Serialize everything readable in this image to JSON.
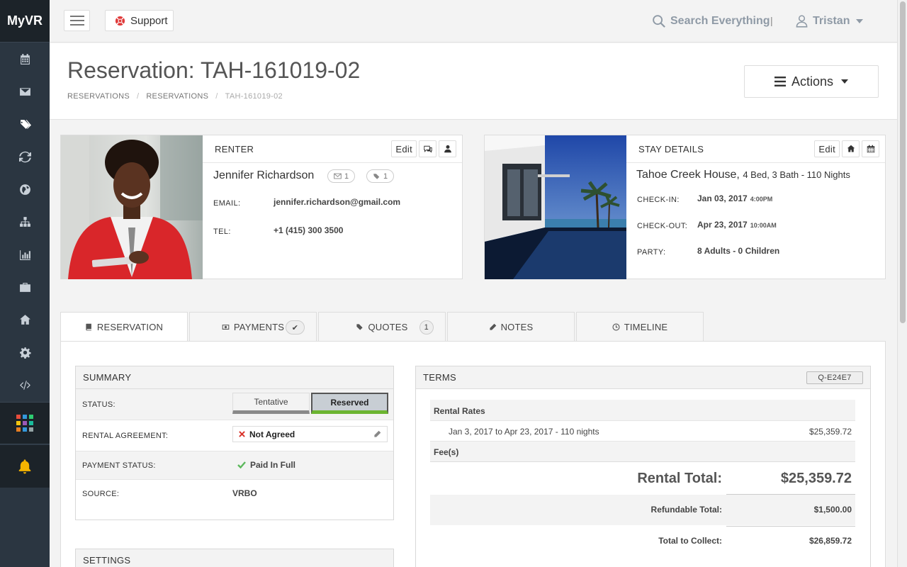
{
  "app": {
    "brand": "MyVR"
  },
  "sidebar": {
    "items": [
      {
        "icon": "calendar-icon"
      },
      {
        "icon": "envelope-icon"
      },
      {
        "icon": "tags-icon"
      },
      {
        "icon": "refresh-icon"
      },
      {
        "icon": "globe-icon"
      },
      {
        "icon": "sitemap-icon"
      },
      {
        "icon": "bar-chart-icon"
      },
      {
        "icon": "briefcase-icon"
      },
      {
        "icon": "home-icon"
      },
      {
        "icon": "gear-icon"
      },
      {
        "icon": "code-icon"
      }
    ],
    "apps_icon": "apps-grid-icon",
    "bell_icon": "bell-icon",
    "bell_color": "#f5b400"
  },
  "topbar": {
    "support_label": "Support",
    "search_label": "Search Everything",
    "separator": "|",
    "user_name": "Tristan"
  },
  "header": {
    "title": "Reservation: TAH-161019-02",
    "breadcrumb": [
      "RESERVATIONS",
      "RESERVATIONS",
      "TAH-161019-02"
    ],
    "actions_label": "Actions"
  },
  "renter": {
    "heading": "RENTER",
    "edit_label": "Edit",
    "name": "Jennifer Richardson",
    "messages_count": "1",
    "tags_count": "1",
    "email_label": "EMAIL:",
    "email": "jennifer.richardson@gmail.com",
    "tel_label": "TEL:",
    "tel": "+1 (415) 300 3500"
  },
  "stay": {
    "heading": "STAY DETAILS",
    "edit_label": "Edit",
    "property": "Tahoe Creek House,",
    "property_details": "4 Bed, 3 Bath - 110 Nights",
    "checkin_label": "CHECK-IN:",
    "checkin_date": "Jan 03, 2017",
    "checkin_time": "4:00PM",
    "checkout_label": "CHECK-OUT:",
    "checkout_date": "Apr 23, 2017",
    "checkout_time": "10:00AM",
    "party_label": "PARTY:",
    "party": "8 Adults - 0 Children"
  },
  "tabs": [
    {
      "label": "RESERVATION",
      "icon": "book-icon"
    },
    {
      "label": "PAYMENTS",
      "icon": "money-icon",
      "badge": "✔"
    },
    {
      "label": "QUOTES",
      "icon": "tags-icon",
      "badge": "1"
    },
    {
      "label": "NOTES",
      "icon": "pencil-icon"
    },
    {
      "label": "TIMELINE",
      "icon": "clock-icon"
    }
  ],
  "summary": {
    "heading": "SUMMARY",
    "status_label": "STATUS:",
    "status_options": [
      "Tentative",
      "Reserved"
    ],
    "status_selected": "Reserved",
    "agreement_label": "RENTAL AGREEMENT:",
    "agreement_value": "Not Agreed",
    "payment_label": "PAYMENT STATUS:",
    "payment_value": "Paid In Full",
    "source_label": "SOURCE:",
    "source_value": "VRBO"
  },
  "settings": {
    "heading": "SETTINGS"
  },
  "terms": {
    "heading": "TERMS",
    "quote_id": "Q-E24E7",
    "rental_rates_label": "Rental Rates",
    "rate_line": "Jan 3, 2017 to Apr 23, 2017 - 110 nights",
    "rate_amount": "$25,359.72",
    "fees_label": "Fee(s)",
    "rental_total_label": "Rental Total:",
    "rental_total": "$25,359.72",
    "refundable_label": "Refundable Total:",
    "refundable": "$1,500.00",
    "collect_label": "Total to Collect:",
    "collect": "$26,859.72"
  },
  "colors": {
    "sidebar_bg": "#2b3641",
    "reserved_bar": "#6cb531",
    "tentative_bar": "#8a8a8a",
    "support_red": "#e03a3a",
    "not_agreed_red": "#d9342b",
    "paid_green": "#5cb85c"
  }
}
